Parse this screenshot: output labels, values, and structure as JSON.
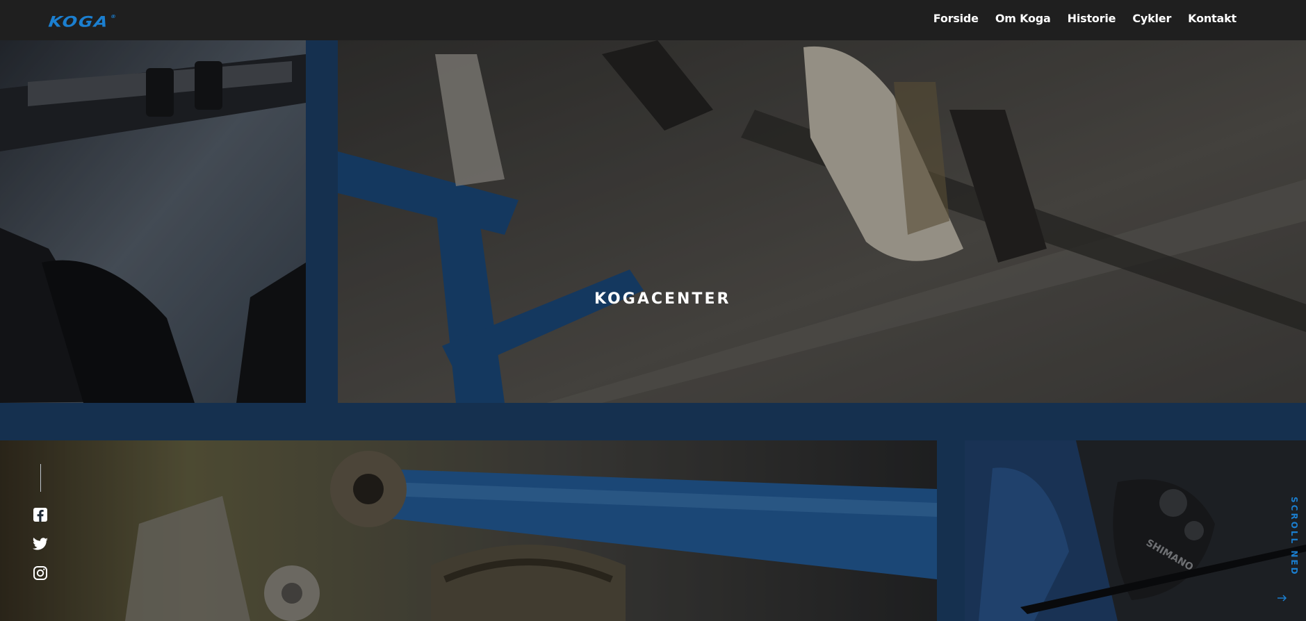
{
  "brand": {
    "logo_text": "KOGA",
    "logo_mark": "®"
  },
  "nav": {
    "items": [
      {
        "label": "Forside"
      },
      {
        "label": "Om Koga"
      },
      {
        "label": "Historie"
      },
      {
        "label": "Cykler"
      },
      {
        "label": "Kontakt"
      }
    ]
  },
  "hero": {
    "title": "KOGACENTER"
  },
  "photos": {
    "bottom_right_brand": "SHIMANO"
  },
  "social": {
    "icons": [
      "facebook-icon",
      "twitter-icon",
      "instagram-icon"
    ]
  },
  "scroll": {
    "label": "SCROLL NED"
  },
  "colors": {
    "nav_bg": "#1f1f1f",
    "frame_blue": "#15304f",
    "accent_blue": "#1b7fd0",
    "text_white": "#ffffff"
  }
}
